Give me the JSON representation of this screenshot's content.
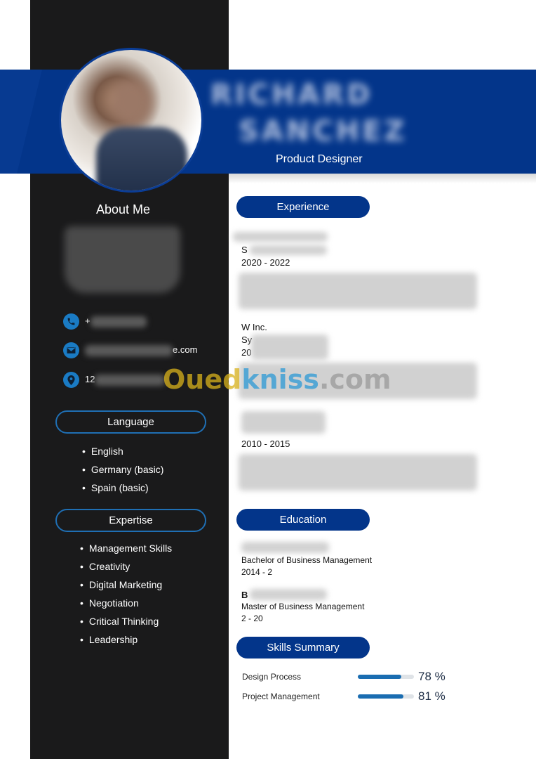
{
  "header": {
    "name_line1": "RICHARD",
    "name_line2": "SANCHEZ",
    "title": "Product Designer"
  },
  "sidebar": {
    "about_title": "About Me",
    "contacts": [
      {
        "icon": "phone-icon",
        "visible_text": "+"
      },
      {
        "icon": "email-icon",
        "visible_text": "e.com"
      },
      {
        "icon": "location-icon",
        "visible_text": "12"
      }
    ],
    "language": {
      "label": "Language",
      "items": [
        "English",
        "Germany (basic)",
        "Spain (basic)"
      ]
    },
    "expertise": {
      "label": "Expertise",
      "items": [
        "Management Skills",
        "Creativity",
        "Digital Marketing",
        "Negotiation",
        "Critical Thinking",
        "Leadership"
      ]
    }
  },
  "main": {
    "experience": {
      "label": "Experience",
      "jobs": [
        {
          "company": "",
          "role": "S",
          "years": "2020 - 2022"
        },
        {
          "company": "W        Inc.",
          "role": "Sy",
          "years": "20"
        },
        {
          "company": "",
          "role": "",
          "years": "2010 - 2015"
        }
      ]
    },
    "education": {
      "label": "Education",
      "items": [
        {
          "school": "",
          "degree": "Bachelor of Business Management",
          "years": "2014 - 2"
        },
        {
          "school": "B",
          "degree": "Master of Business Management",
          "years": "2   - 20"
        }
      ]
    },
    "skills": {
      "label": "Skills Summary",
      "items": [
        {
          "name": "Design Process",
          "percent": 78,
          "percent_label": "78 %"
        },
        {
          "name": "Project Management",
          "percent": 81,
          "percent_label": "81 %"
        }
      ]
    }
  },
  "watermark": {
    "part1": "Oued",
    "part2": "kniss",
    "part3": ".com"
  },
  "colors": {
    "brand_blue": "#03358a",
    "accent_blue": "#1a7bc4",
    "sidebar_bg": "#1a1a1b"
  }
}
